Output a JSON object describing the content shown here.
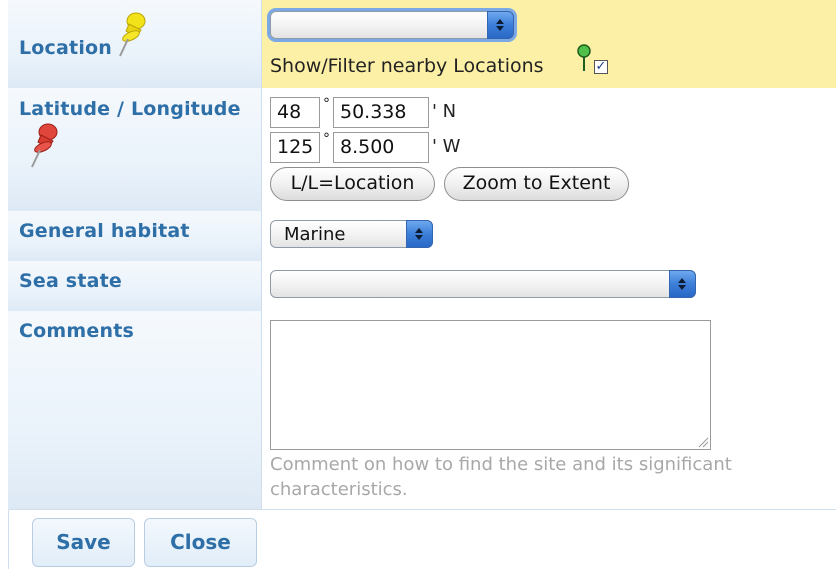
{
  "location": {
    "label": "Location",
    "select_value": "",
    "filter_label": "Show/Filter nearby Locations",
    "filter_checked": true,
    "pin_icon": "yellow-pushpin-icon",
    "filter_icon": "green-map-marker-icon"
  },
  "latlng": {
    "label": "Latitude / Longitude",
    "pin_icon": "red-pushpin-icon",
    "lat_degrees": "48",
    "lat_minutes": "50.338",
    "lat_hemisphere": "' N",
    "lng_degrees": "125",
    "lng_minutes": "8.500",
    "lng_hemisphere": "' W",
    "degree_symbol": "°",
    "ll_location_button": "L/L=Location",
    "zoom_button": "Zoom to Extent"
  },
  "habitat": {
    "label": "General habitat",
    "value": "Marine"
  },
  "sea_state": {
    "label": "Sea state",
    "value": ""
  },
  "comments": {
    "label": "Comments",
    "value": "",
    "hint": "Comment on how to find the site and its significant characteristics."
  },
  "footer": {
    "save_label": "Save",
    "close_label": "Close"
  },
  "colors": {
    "label_text": "#2e6fa7",
    "highlight_row": "#fcf0a6",
    "hint_text": "#a8a8a8"
  }
}
